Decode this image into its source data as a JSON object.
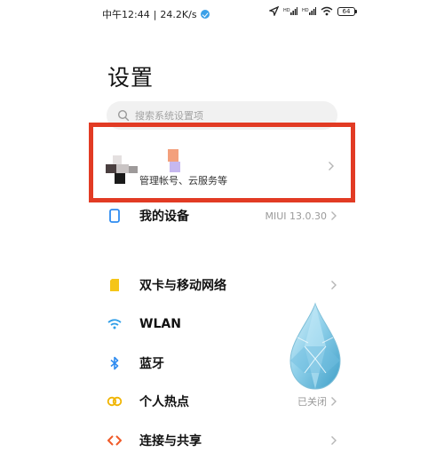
{
  "status_bar": {
    "time": "中午12:44",
    "separator": "|",
    "speed": "24.2K/s",
    "battery": "64"
  },
  "header": {
    "title": "设置"
  },
  "search": {
    "placeholder": "搜索系统设置项"
  },
  "account": {
    "subtitle": "管理帐号、云服务等"
  },
  "items": [
    {
      "label": "我的设备",
      "value": "MIUI 13.0.30",
      "icon": "phone-icon",
      "color": "#2f8cf0"
    },
    {
      "label": "双卡与移动网络",
      "value": "",
      "icon": "sim-card-icon",
      "color": "#f5c518"
    },
    {
      "label": "WLAN",
      "value": "",
      "icon": "wifi-icon",
      "color": "#2f9ee8"
    },
    {
      "label": "蓝牙",
      "value": "",
      "icon": "bluetooth-icon",
      "color": "#2f8cf0"
    },
    {
      "label": "个人热点",
      "value": "已关闭",
      "icon": "hotspot-icon",
      "color": "#f0b400"
    },
    {
      "label": "连接与共享",
      "value": "",
      "icon": "share-icon",
      "color": "#f05a28"
    }
  ],
  "colors": {
    "highlight_border": "#e23b24",
    "search_bg": "#f1f1f1"
  }
}
